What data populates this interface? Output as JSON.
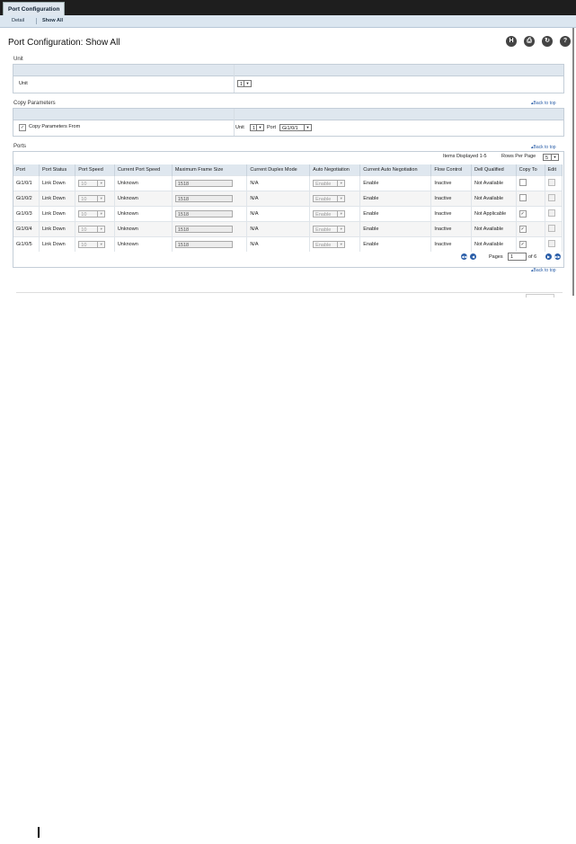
{
  "tabs": {
    "main": "Port Configuration",
    "detail": "Detail",
    "show_all": "Show All"
  },
  "page_title": "Port Configuration: Show All",
  "toolbar": {
    "h_label": "H",
    "print_label": "⎙",
    "refresh_label": "↻",
    "help_label": "?"
  },
  "unit_section": {
    "title": "Unit",
    "label": "Unit",
    "value": "1"
  },
  "copy_section": {
    "title": "Copy Parameters",
    "back_to_top": "Back to top",
    "checkbox_label": "Copy Parameters From",
    "checked_mark": "✓",
    "unit_label": "Unit",
    "unit_value": "1",
    "port_label": "Port",
    "port_value": "Gi1/0/1"
  },
  "ports_section": {
    "title": "Ports",
    "back_to_top": "Back to top",
    "items_displayed": "Items Displayed 1-5",
    "rows_per_page_label": "Rows Per Page",
    "rows_per_page_value": "5"
  },
  "table": {
    "headers": [
      "Port",
      "Port Status",
      "Port Speed",
      "Current Port Speed",
      "Maximum Frame Size",
      "Current Duplex Mode",
      "Auto Negotiation",
      "Current Auto Negotiation",
      "Flow Control",
      "Dell Qualified",
      "Copy To",
      "Edit"
    ],
    "rows": [
      {
        "port": "Gi1/0/1",
        "status": "Link Down",
        "speed": "10",
        "current_speed": "Unknown",
        "frame_size": "1518",
        "duplex": "N/A",
        "auto_neg": "Enable",
        "current_auto_neg": "Enable",
        "flow": "Inactive",
        "dell": "Not Available",
        "copy": ""
      },
      {
        "port": "Gi1/0/2",
        "status": "Link Down",
        "speed": "10",
        "current_speed": "Unknown",
        "frame_size": "1518",
        "duplex": "N/A",
        "auto_neg": "Enable",
        "current_auto_neg": "Enable",
        "flow": "Inactive",
        "dell": "Not Available",
        "copy": ""
      },
      {
        "port": "Gi1/0/3",
        "status": "Link Down",
        "speed": "10",
        "current_speed": "Unknown",
        "frame_size": "1518",
        "duplex": "N/A",
        "auto_neg": "Enable",
        "current_auto_neg": "Enable",
        "flow": "Inactive",
        "dell": "Not Applicable",
        "copy": "✓"
      },
      {
        "port": "Gi1/0/4",
        "status": "Link Down",
        "speed": "10",
        "current_speed": "Unknown",
        "frame_size": "1518",
        "duplex": "N/A",
        "auto_neg": "Enable",
        "current_auto_neg": "Enable",
        "flow": "Inactive",
        "dell": "Not Available",
        "copy": "✓"
      },
      {
        "port": "Gi1/0/5",
        "status": "Link Down",
        "speed": "10",
        "current_speed": "Unknown",
        "frame_size": "1518",
        "duplex": "N/A",
        "auto_neg": "Enable",
        "current_auto_neg": "Enable",
        "flow": "Inactive",
        "dell": "Not Available",
        "copy": "✓"
      }
    ]
  },
  "pager": {
    "pages_label": "Pages",
    "page_value": "1",
    "of_label": "of 6",
    "first": "◀◀",
    "prev": "◀",
    "next": "▶",
    "last": "▶▶"
  },
  "arrow_glyph": "▼",
  "colors": {
    "header_bg": "#dfe7ef",
    "tabbar_bg": "#1e1e1e",
    "link": "#2a5ea8"
  }
}
